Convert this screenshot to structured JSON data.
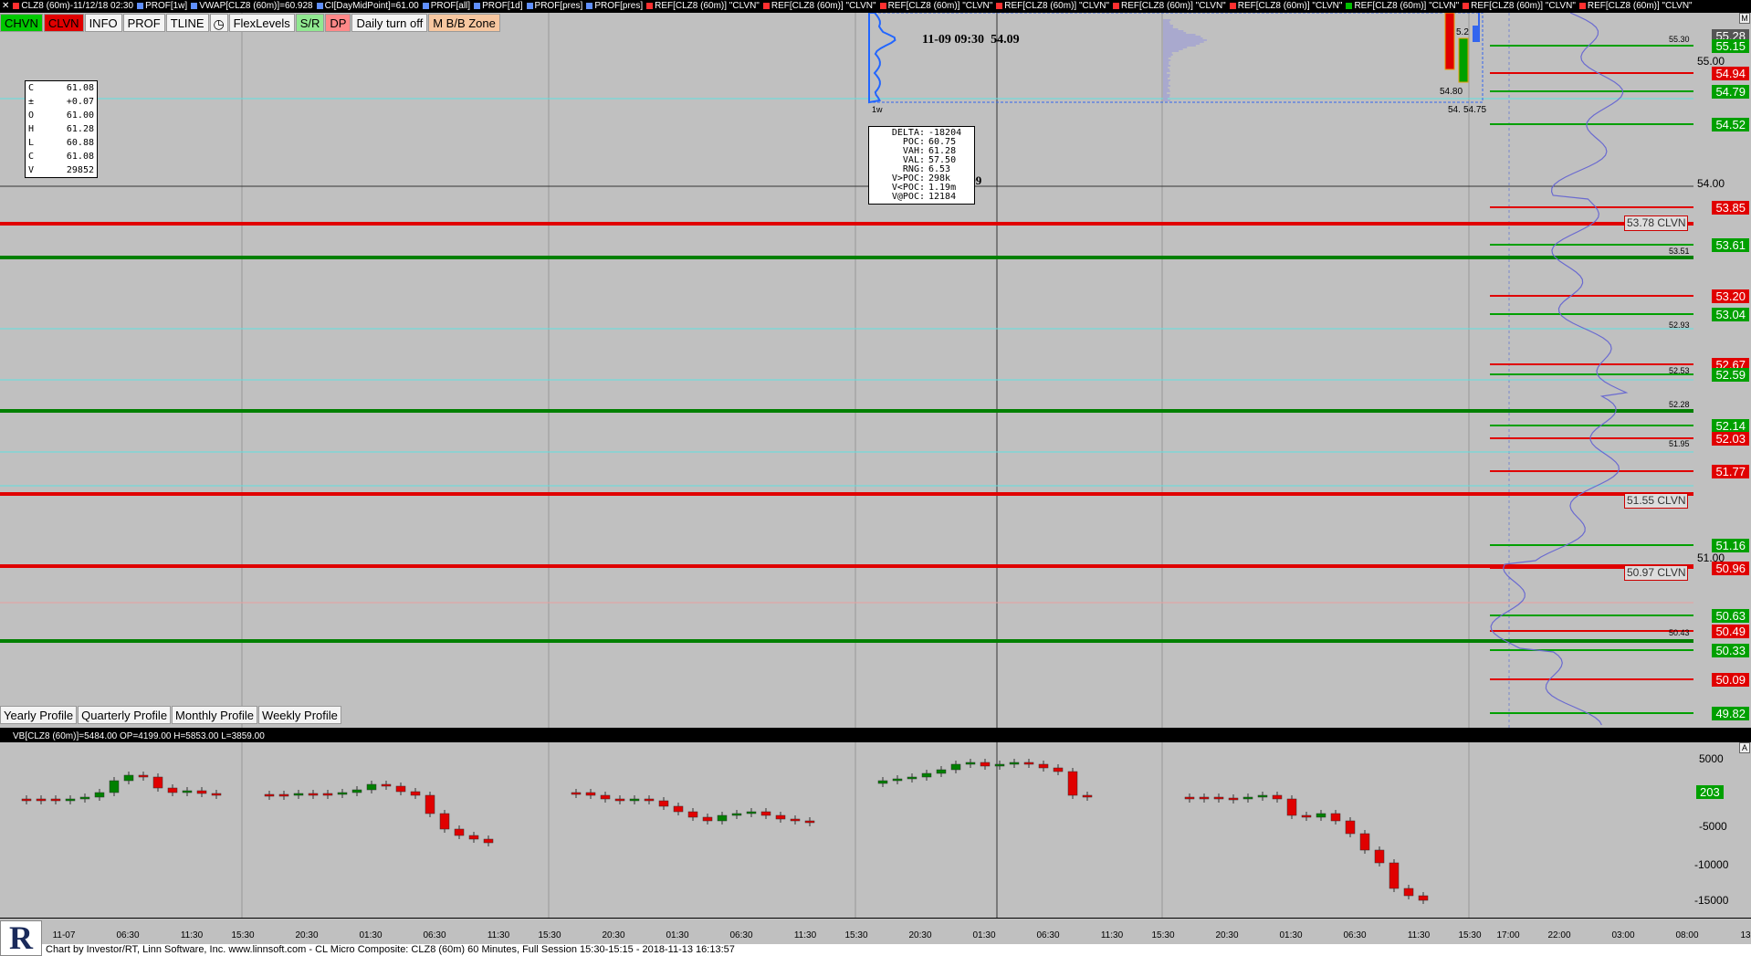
{
  "titlebar": {
    "segments": [
      {
        "text": "CLZ8 (60m)-11/12/18 02:30",
        "color": "#ff3030"
      },
      {
        "text": "PROF[1w]",
        "color": "#6090ff"
      },
      {
        "text": "VWAP[CLZ8 (60m)]=60.928",
        "color": "#6090ff"
      },
      {
        "text": "CI[DayMidPoint]=61.00",
        "color": "#6090ff"
      },
      {
        "text": "PROF[all]",
        "color": "#6090ff"
      },
      {
        "text": "PROF[1d]",
        "color": "#6090ff"
      },
      {
        "text": "PROF[pres]",
        "color": "#6090ff"
      },
      {
        "text": "PROF[pres]",
        "color": "#6090ff"
      },
      {
        "text": "REF[CLZ8 (60m)] \"CLVN\"",
        "color": "#ff3030"
      },
      {
        "text": "REF[CLZ8 (60m)] \"CLVN\"",
        "color": "#ff3030"
      },
      {
        "text": "REF[CLZ8 (60m)] \"CLVN\"",
        "color": "#ff3030"
      },
      {
        "text": "REF[CLZ8 (60m)] \"CLVN\"",
        "color": "#ff3030"
      },
      {
        "text": "REF[CLZ8 (60m)] \"CLVN\"",
        "color": "#ff3030"
      },
      {
        "text": "REF[CLZ8 (60m)] \"CLVN\"",
        "color": "#ff3030"
      },
      {
        "text": "REF[CLZ8 (60m)] \"CLVN\"",
        "color": "#00c000"
      },
      {
        "text": "REF[CLZ8 (60m)] \"CLVN\"",
        "color": "#ff3030"
      },
      {
        "text": "REF[CLZ8 (60m)] \"CLVN\"",
        "color": "#ff3030"
      }
    ]
  },
  "toolbar": {
    "chvn": "CHVN",
    "clvn": "CLVN",
    "info": "INFO",
    "prof": "PROF",
    "tline": "TLINE",
    "clock": "◷",
    "flex": "FlexLevels",
    "sr": "S/R",
    "dp": "DP",
    "daily": "Daily turn off",
    "zone": "M B/B Zone"
  },
  "ohlc": {
    "rows": [
      {
        "k": "C",
        "v": "61.08"
      },
      {
        "k": "±",
        "v": "+0.07"
      },
      {
        "k": "O",
        "v": "61.00"
      },
      {
        "k": "H",
        "v": "61.28"
      },
      {
        "k": "L",
        "v": "60.88"
      },
      {
        "k": "C",
        "v": "61.08"
      },
      {
        "k": "V",
        "v": "29852"
      }
    ]
  },
  "crosshair": {
    "datetime": "11-09 09:30",
    "price": "54.09",
    "price_label": "54.09"
  },
  "profile_label": "1w",
  "delta": {
    "rows": [
      {
        "k": "DELTA:",
        "v": "-18204"
      },
      {
        "k": "POC:",
        "v": "60.75"
      },
      {
        "k": "VAH:",
        "v": "61.28"
      },
      {
        "k": "VAL:",
        "v": "57.50"
      },
      {
        "k": "RNG:",
        "v": "6.53"
      },
      {
        "k": "V>POC:",
        "v": "298k"
      },
      {
        "k": "V<POC:",
        "v": "1.19m"
      },
      {
        "k": "V@POC:",
        "v": "12184"
      }
    ]
  },
  "right_axis": {
    "levels": [
      {
        "text": "55.28",
        "style": "d"
      },
      {
        "text": "55.15",
        "style": "g"
      },
      {
        "text": "54.94",
        "style": "r"
      },
      {
        "text": "54.79",
        "style": "g"
      },
      {
        "text": "54.52",
        "style": "g"
      },
      {
        "text": "53.85",
        "style": "r"
      },
      {
        "text": "53.61",
        "style": "g"
      },
      {
        "text": "53.20",
        "style": "r"
      },
      {
        "text": "53.04",
        "style": "g"
      },
      {
        "text": "52.67",
        "style": "r"
      },
      {
        "text": "52.59",
        "style": "g"
      },
      {
        "text": "52.14",
        "style": "g"
      },
      {
        "text": "52.03",
        "style": "r"
      },
      {
        "text": "51.77",
        "style": "r"
      },
      {
        "text": "51.16",
        "style": "g"
      },
      {
        "text": "50.96",
        "style": "r"
      },
      {
        "text": "50.63",
        "style": "g"
      },
      {
        "text": "50.49",
        "style": "r"
      },
      {
        "text": "50.33",
        "style": "g"
      },
      {
        "text": "50.09",
        "style": "r"
      },
      {
        "text": "49.82",
        "style": "g"
      }
    ],
    "scale_labels": [
      "55.00",
      "54.00",
      "51.00"
    ],
    "small_labels": [
      "55.30",
      "53.51",
      "52.93",
      "52.53",
      "52.28",
      "51.95",
      "50.43"
    ]
  },
  "clvn_tags": [
    "53.78 CLVN",
    "51.55 CLVN",
    "50.97 CLVN"
  ],
  "candle_labels": [
    "5.2",
    "54.80",
    "54.",
    "54.75"
  ],
  "profile_tabs": [
    "Yearly Profile",
    "Quarterly Profile",
    "Monthly Profile",
    "Weekly Profile"
  ],
  "lower_pane": {
    "title": "VB[CLZ8 (60m)]=5484.00 OP=4199.00 H=5853.00 L=3859.00",
    "axis_labels": [
      "5000",
      "-5000",
      "-10000",
      "-15000"
    ],
    "current": "203"
  },
  "time_axis": [
    "11-07",
    "06:30",
    "11:30",
    "15:30",
    "20:30",
    "01:30",
    "06:30",
    "11:30",
    "15:30",
    "20:30",
    "01:30",
    "06:30",
    "11:30",
    "15:30",
    "20:30",
    "01:30",
    "06:30",
    "11:30",
    "15:30",
    "20:30",
    "01:30",
    "06:30",
    "11:30",
    "15:30",
    "17:00",
    "22:00",
    "03:00",
    "08:00",
    "13"
  ],
  "footer": "Chart by Investor/RT, Linn Software, Inc. www.linnsoft.com - CL Micro Composite: CLZ8 (60m) 60 Minutes, Full Session 15:30-15:15 - 2018-11-13 16:13:57",
  "logo": "R",
  "corner": {
    "m": "M",
    "a": "A"
  }
}
